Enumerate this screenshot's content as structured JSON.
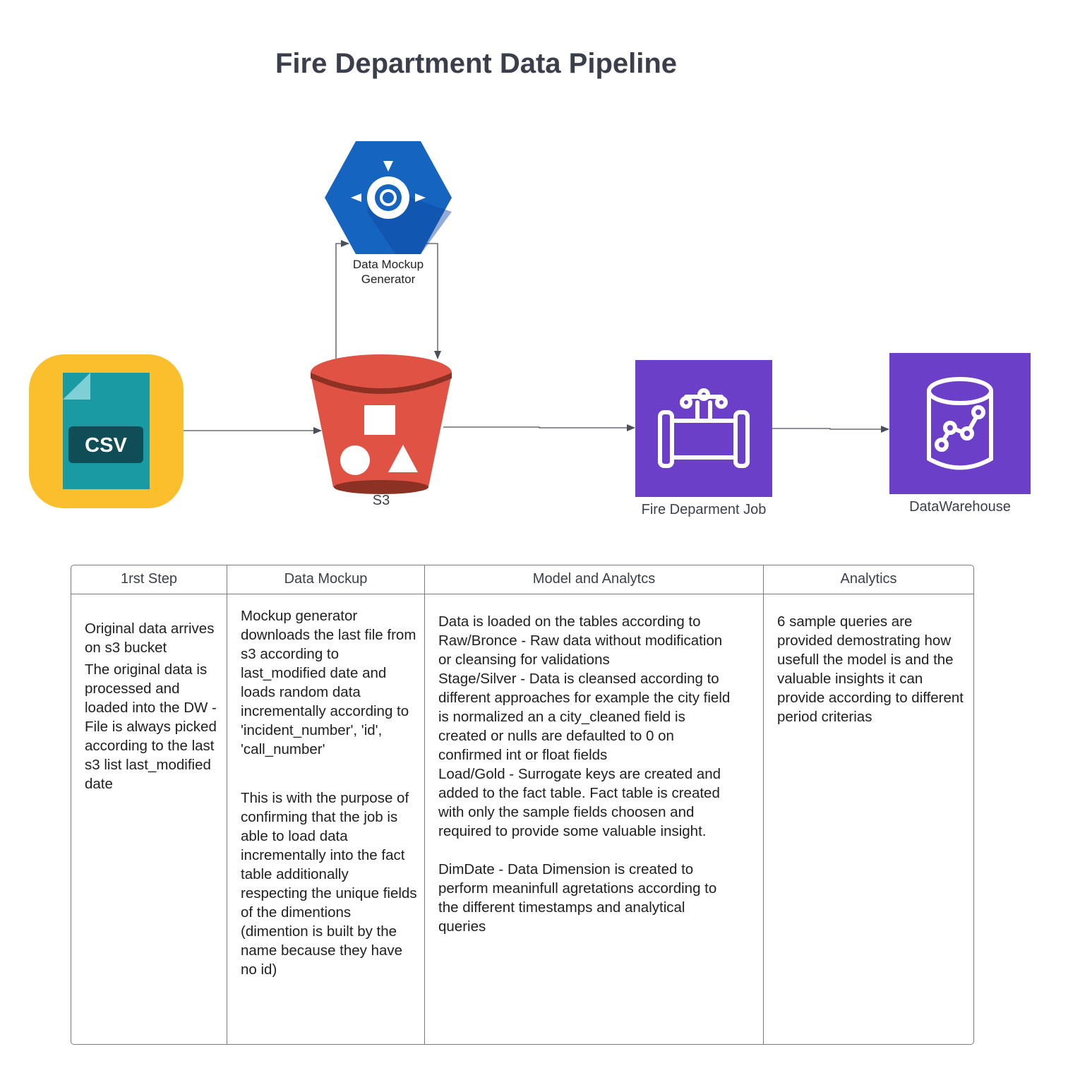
{
  "title": "Fire Department Data Pipeline",
  "nodes": {
    "csv": {
      "badge": "CSV",
      "color": "#fbbf2d",
      "file_color": "#1a9aa3",
      "badge_color": "#0f4e56"
    },
    "generator": {
      "label_line1": "Data Mockup",
      "label_line2": "Generator",
      "color": "#1565c0"
    },
    "s3": {
      "label": "S3",
      "color": "#e05243",
      "rim_color": "#8c3123"
    },
    "job": {
      "label": "Fire Deparment Job",
      "color": "#6b3fc7"
    },
    "warehouse": {
      "label": "DataWarehouse",
      "color": "#6b3fc7"
    }
  },
  "table": {
    "columns": [
      {
        "header": "1rst Step",
        "paragraphs": [
          "Original data arrives on s3 bucket",
          "The original data is processed and loaded into the DW - File is always picked according to the last s3 list last_modified date"
        ]
      },
      {
        "header": "Data Mockup",
        "paragraphs": [
          "Mockup generator downloads the last file from s3 according to last_modified date and loads random data incrementally according to 'incident_number', 'id', 'call_number'",
          "This is with the purpose of confirming that the job is able to load data incrementally into the fact table additionally respecting the unique fields of the dimentions (dimention is built by the name because they have no id)"
        ]
      },
      {
        "header": "Model and Analytcs",
        "paragraphs": [
          "Data is loaded on the tables according to",
          "Raw/Bronce - Raw data without modification or cleansing for validations",
          "Stage/Silver - Data is cleansed according to different approaches for example the city field is normalized an a city_cleaned field is created or nulls are defaulted to 0 on confirmed int or float fields",
          "Load/Gold - Surrogate keys are created and added to the fact table. Fact table is created with only the sample fields choosen and required to provide some valuable insight.",
          "DimDate - Data Dimension is created to perform meaninfull agretations according to the different timestamps and analytical queries"
        ]
      },
      {
        "header": "Analytics",
        "paragraphs": [
          "6 sample queries are provided demostrating how usefull the model is and the valuable insights it can provide according to different period criterias"
        ]
      }
    ]
  }
}
